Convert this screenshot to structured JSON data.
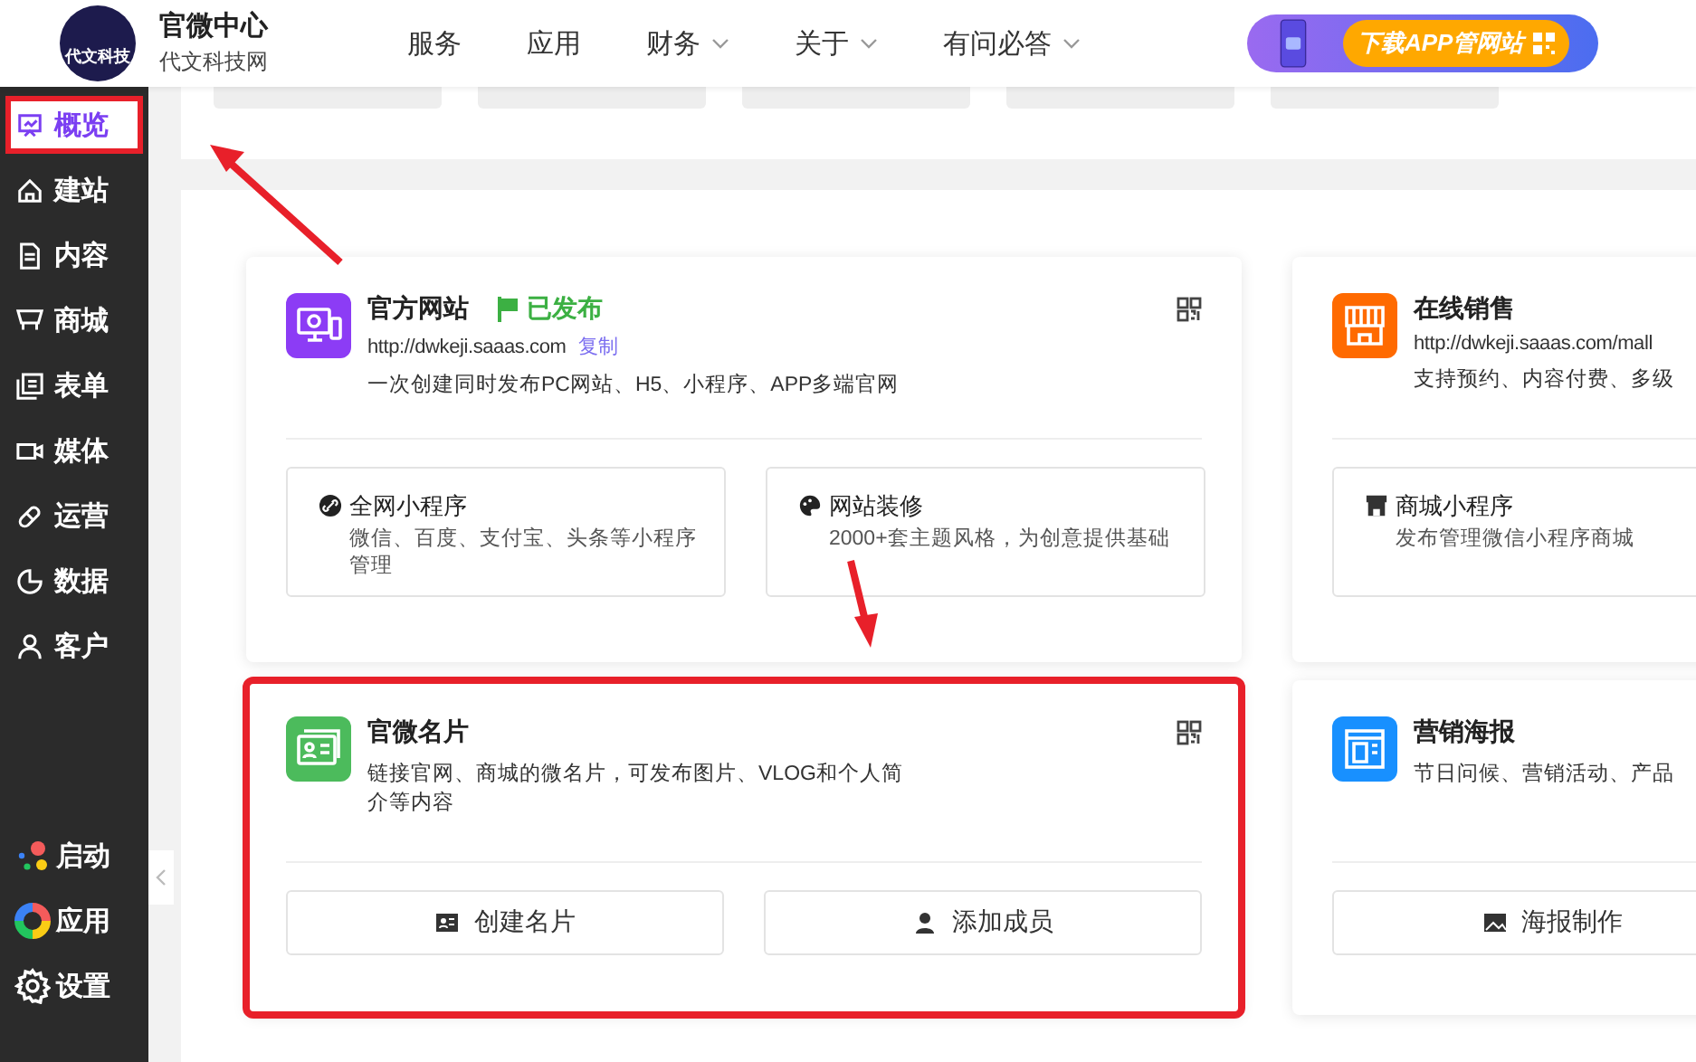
{
  "header": {
    "logo_text": "代文科技",
    "title": "官微中心",
    "subtitle": "代文科技网",
    "nav": [
      {
        "label": "服务",
        "dropdown": false
      },
      {
        "label": "应用",
        "dropdown": false
      },
      {
        "label": "财务",
        "dropdown": true
      },
      {
        "label": "关于",
        "dropdown": true
      },
      {
        "label": "有问必答",
        "dropdown": true
      }
    ],
    "banner": {
      "button": "下载APP管网站"
    }
  },
  "sidebar": {
    "items": [
      {
        "label": "概览",
        "selected": true,
        "highlighted": true
      },
      {
        "label": "建站",
        "selected": false,
        "highlighted": false
      },
      {
        "label": "内容",
        "selected": false,
        "highlighted": false
      },
      {
        "label": "商城",
        "selected": false,
        "highlighted": false
      },
      {
        "label": "表单",
        "selected": false,
        "highlighted": false
      },
      {
        "label": "媒体",
        "selected": false,
        "highlighted": false
      },
      {
        "label": "运营",
        "selected": false,
        "highlighted": false
      },
      {
        "label": "数据",
        "selected": false,
        "highlighted": false
      },
      {
        "label": "客户",
        "selected": false,
        "highlighted": false
      }
    ],
    "bottom_items": [
      {
        "label": "启动"
      },
      {
        "label": "应用"
      },
      {
        "label": "设置"
      }
    ]
  },
  "cards": [
    {
      "title": "官方网站",
      "color": "#8c3cf5",
      "status": "已发布",
      "url": "http://dwkeji.saaas.com",
      "copy_link": "复制",
      "description": "一次创建同时发布PC网站、H5、小程序、APP多端官网",
      "highlighted": false,
      "qr": true,
      "features": [
        {
          "title": "全网小程序",
          "description": "微信、百度、支付宝、头条等小程序管理"
        },
        {
          "title": "网站装修",
          "description": "2000+套主题风格，为创意提供基础"
        }
      ]
    },
    {
      "title": "在线销售",
      "color": "#ff6a00",
      "url": "http://dwkeji.saaas.com/mall",
      "description": "支持预约、内容付费、多级",
      "highlighted": false,
      "features": [
        {
          "title": "商城小程序",
          "description": "发布管理微信小程序商城"
        }
      ]
    },
    {
      "title": "官微名片",
      "color": "#4cbb5c",
      "description": "链接官网、商城的微名片，可发布图片、VLOG和个人简介等内容",
      "highlighted": true,
      "qr": true,
      "actions": [
        {
          "label": "创建名片"
        },
        {
          "label": "添加成员"
        }
      ]
    },
    {
      "title": "营销海报",
      "color": "#1890ff",
      "description": "节日问候、营销活动、产品",
      "highlighted": false,
      "actions": [
        {
          "label": "海报制作"
        }
      ]
    }
  ]
}
